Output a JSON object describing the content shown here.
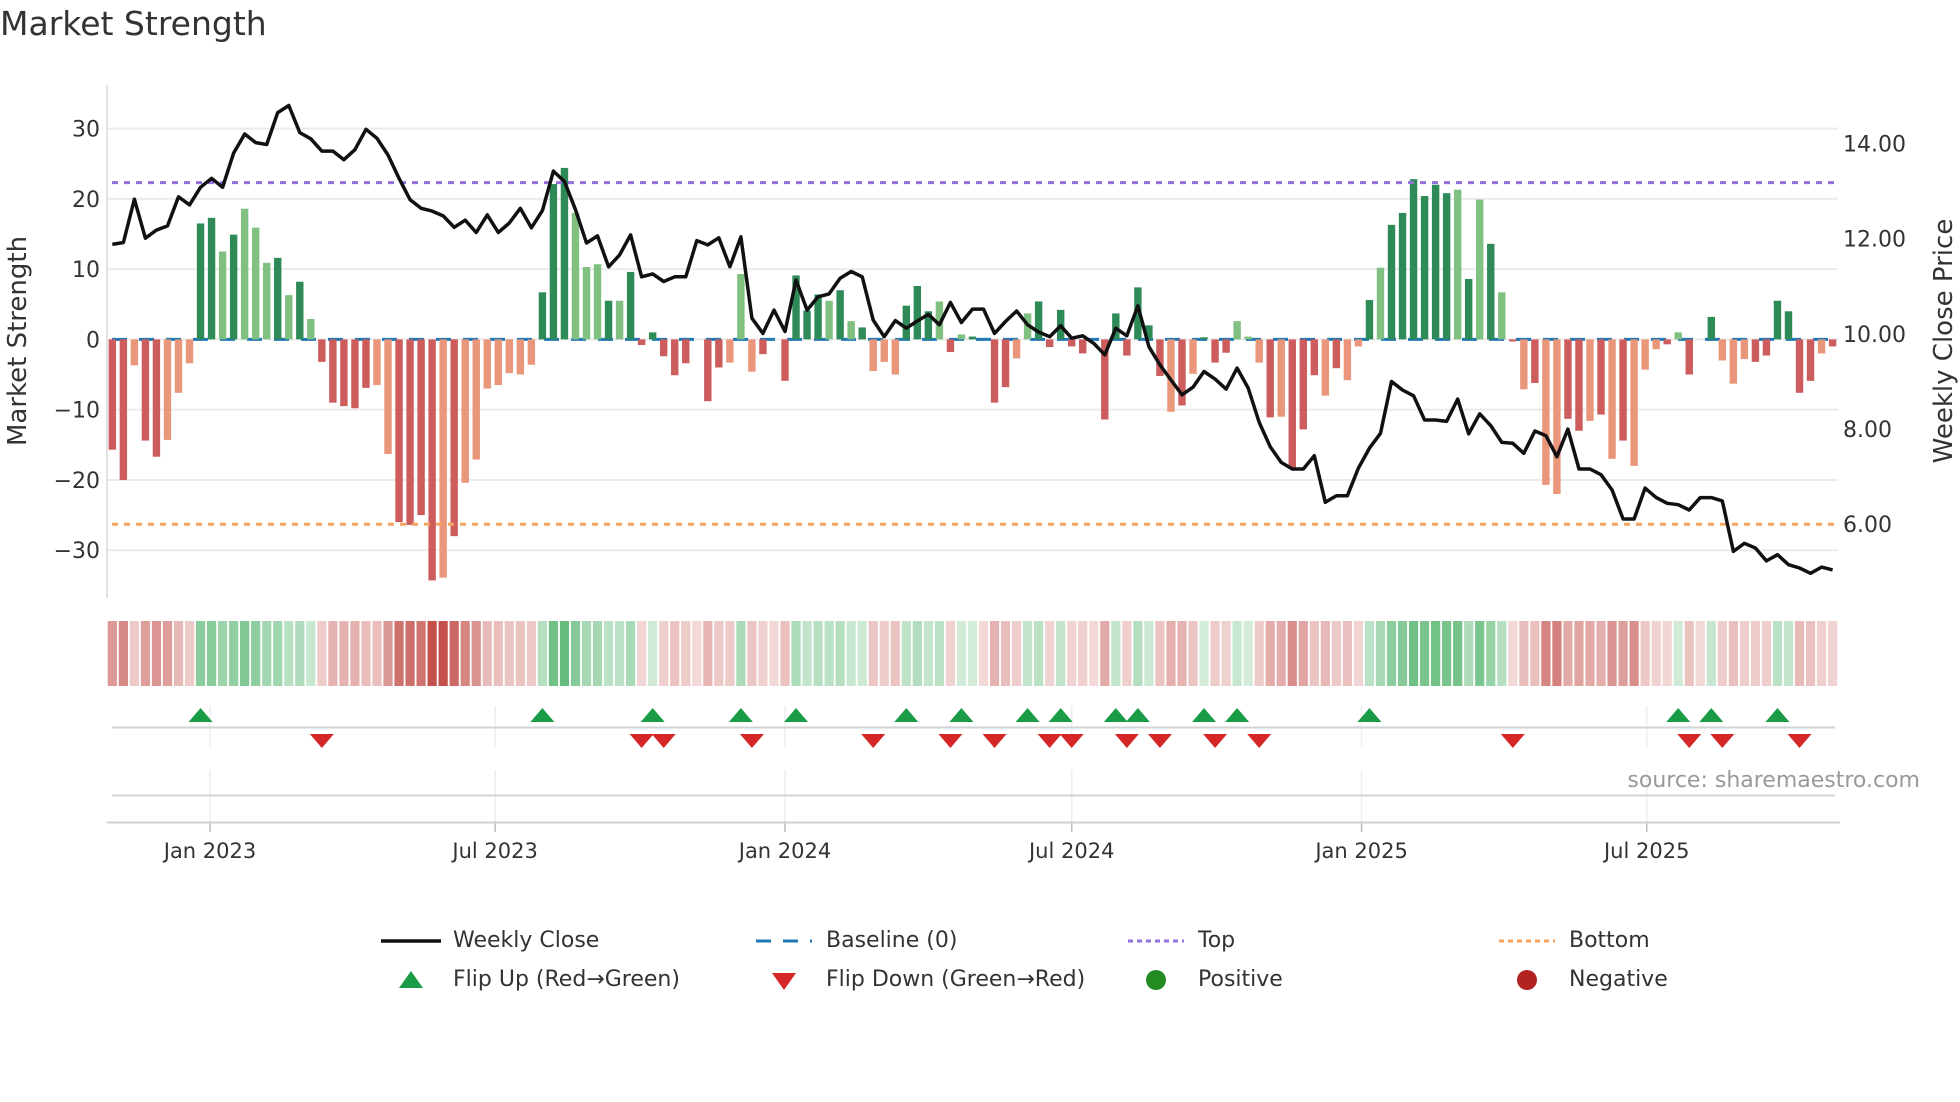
{
  "title": "Market Strength",
  "source": "source: sharemaestro.com",
  "colors": {
    "pos_dark": "#2e8b57",
    "pos_light": "#80c080",
    "neg_dark": "#cd5c5c",
    "neg_light": "#e9967a",
    "price_line": "#111111",
    "baseline": "#1f77b4",
    "top": "#9370db",
    "bottom": "#f4a460",
    "flip_up": "#1a9c47",
    "flip_down": "#d62728",
    "positive": "#228b22",
    "negative": "#b22222",
    "grid": "#ebebeb",
    "heat_pos": "#3caa5a",
    "heat_neg": "#c3504a"
  },
  "legend": [
    {
      "key": "weekly-close",
      "label": "Weekly Close"
    },
    {
      "key": "baseline",
      "label": "Baseline (0)"
    },
    {
      "key": "top",
      "label": "Top"
    },
    {
      "key": "bottom",
      "label": "Bottom"
    },
    {
      "key": "flip-up",
      "label": "Flip Up (Red→Green)"
    },
    {
      "key": "flip-down",
      "label": "Flip Down (Green→Red)"
    },
    {
      "key": "positive",
      "label": "Positive"
    },
    {
      "key": "negative",
      "label": "Negative"
    }
  ],
  "chart_data": {
    "type": "bar",
    "title": "Market Strength",
    "ylabel": "Market Strength",
    "y2label": "Weekly Close Price",
    "start_week": "2022-10-31",
    "frequency": "weekly",
    "ylim": [
      -36.8,
      36.2
    ],
    "y2lim": [
      4.45,
      15.23
    ],
    "grid": true,
    "legend_placement": "bottom",
    "top_level": 22.3,
    "bottom_level": -26.3,
    "baseline": 0,
    "yticks": [
      {
        "value": -30,
        "label": "−30"
      },
      {
        "value": -20,
        "label": "−20"
      },
      {
        "value": -10,
        "label": "−10"
      },
      {
        "value": 0,
        "label": "0"
      },
      {
        "value": 10,
        "label": "10"
      },
      {
        "value": 20,
        "label": "20"
      },
      {
        "value": 30,
        "label": "30"
      }
    ],
    "y2ticks": [
      {
        "value": 6,
        "label": "6.00"
      },
      {
        "value": 8,
        "label": "8.00"
      },
      {
        "value": 10,
        "label": "10.00"
      },
      {
        "value": 12,
        "label": "12.00"
      },
      {
        "value": 14,
        "label": "14.00"
      }
    ],
    "xticks": [
      {
        "date": "2023-01-01",
        "label": "Jan 2023"
      },
      {
        "date": "2023-07-01",
        "label": "Jul 2023"
      },
      {
        "date": "2024-01-01",
        "label": "Jan 2024"
      },
      {
        "date": "2024-07-01",
        "label": "Jul 2024"
      },
      {
        "date": "2025-01-01",
        "label": "Jan 2025"
      },
      {
        "date": "2025-07-01",
        "label": "Jul 2025"
      }
    ],
    "strength": [
      -15.7,
      -20.0,
      -3.7,
      -14.4,
      -16.7,
      -14.3,
      -7.6,
      -3.4,
      16.5,
      17.3,
      12.5,
      14.9,
      18.6,
      15.9,
      10.9,
      11.6,
      6.3,
      8.2,
      2.9,
      -3.2,
      -9.0,
      -9.5,
      -9.8,
      -6.9,
      -6.5,
      -16.3,
      -26.0,
      -26.4,
      -25.0,
      -34.3,
      -33.9,
      -28.0,
      -20.4,
      -17.1,
      -7.0,
      -6.5,
      -4.8,
      -5.0,
      -3.6,
      6.7,
      22.1,
      24.4,
      18.0,
      10.3,
      10.7,
      5.5,
      5.5,
      9.6,
      -0.8,
      1.0,
      -2.4,
      -5.1,
      -3.4,
      0,
      -8.8,
      -4.0,
      -3.3,
      9.3,
      -4.6,
      -2.1,
      0,
      -5.9,
      9.1,
      4.1,
      6.4,
      5.5,
      7.0,
      2.6,
      1.7,
      -4.5,
      -3.2,
      -5.0,
      4.8,
      7.6,
      4.0,
      5.4,
      -1.8,
      0.7,
      0.4,
      0,
      -9.0,
      -6.8,
      -2.7,
      3.7,
      5.4,
      -1.1,
      4.2,
      -1.0,
      -2.0,
      0,
      -11.4,
      3.7,
      -2.3,
      7.4,
      2.0,
      -5.2,
      -10.3,
      -9.4,
      -4.9,
      0.3,
      -3.3,
      -1.9,
      2.6,
      0.4,
      -3.3,
      -11.1,
      -11.0,
      -18.4,
      -12.8,
      -5.1,
      -8.0,
      -4.1,
      -5.8,
      -1.0,
      5.6,
      10.2,
      16.3,
      18.0,
      22.8,
      20.4,
      22.0,
      20.8,
      21.3,
      8.6,
      19.9,
      13.6,
      6.7,
      -0.3,
      -7.1,
      -6.2,
      -20.7,
      -22.0,
      -11.3,
      -13.0,
      -11.6,
      -10.7,
      -17.0,
      -14.4,
      -18.0,
      -4.3,
      -1.4,
      -0.7,
      1.0,
      -5.0,
      0,
      3.2,
      -3.0,
      -6.3,
      -2.8,
      -3.2,
      -2.3,
      5.5,
      4.0,
      -7.6,
      -5.9,
      -2.0,
      -1.0
    ],
    "shade": "ddlddlllddldllldldldddddllddddldllllllldddllldlddddddlndllldldnddldldllldddldldlndlldddddddddnddldldddllldldddldlldlddddddldldldldllddldldllldldldlllddndddldldllll",
    "weekly_close": [
      11.88,
      11.92,
      12.83,
      12.01,
      12.18,
      12.27,
      12.88,
      12.71,
      13.08,
      13.27,
      13.08,
      13.8,
      14.2,
      14.02,
      13.98,
      14.65,
      14.8,
      14.23,
      14.1,
      13.84,
      13.84,
      13.66,
      13.87,
      14.3,
      14.11,
      13.76,
      13.27,
      12.82,
      12.64,
      12.58,
      12.48,
      12.24,
      12.39,
      12.13,
      12.5,
      12.13,
      12.33,
      12.64,
      12.23,
      12.59,
      13.42,
      13.2,
      12.61,
      11.91,
      12.06,
      11.41,
      11.66,
      12.08,
      11.2,
      11.26,
      11.1,
      11.2,
      11.2,
      11.96,
      11.87,
      12.02,
      11.41,
      12.04,
      10.33,
      10.01,
      10.5,
      10.05,
      11.13,
      10.5,
      10.78,
      10.84,
      11.17,
      11.31,
      11.2,
      10.29,
      9.94,
      10.28,
      10.12,
      10.27,
      10.41,
      10.19,
      10.66,
      10.24,
      10.52,
      10.52,
      10.01,
      10.26,
      10.48,
      10.19,
      10.04,
      9.94,
      10.17,
      9.91,
      9.96,
      9.8,
      9.56,
      10.12,
      9.96,
      10.59,
      9.73,
      9.35,
      9.03,
      8.72,
      8.88,
      9.21,
      9.05,
      8.84,
      9.28,
      8.86,
      8.14,
      7.63,
      7.3,
      7.16,
      7.16,
      7.44,
      6.46,
      6.6,
      6.6,
      7.18,
      7.6,
      7.91,
      9.0,
      8.82,
      8.7,
      8.19,
      8.19,
      8.16,
      8.63,
      7.9,
      8.32,
      8.07,
      7.72,
      7.7,
      7.49,
      7.96,
      7.86,
      7.42,
      8.0,
      7.16,
      7.16,
      7.04,
      6.72,
      6.11,
      6.11,
      6.76,
      6.56,
      6.44,
      6.41,
      6.3,
      6.56,
      6.56,
      6.49,
      5.43,
      5.6,
      5.5,
      5.23,
      5.36,
      5.15,
      5.08,
      4.97,
      5.1,
      5.04
    ],
    "flip_up_weeks": [
      9,
      40,
      50,
      58,
      63,
      73,
      78,
      84,
      87,
      92,
      94,
      100,
      103,
      115,
      143,
      146,
      152
    ],
    "flip_down_weeks": [
      20,
      49,
      51,
      59,
      70,
      77,
      81,
      86,
      88,
      93,
      96,
      101,
      105,
      128,
      144,
      147,
      154
    ]
  }
}
